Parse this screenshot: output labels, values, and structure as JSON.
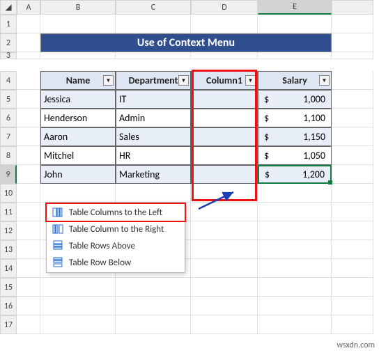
{
  "columns": [
    "A",
    "B",
    "C",
    "D",
    "E"
  ],
  "rows": [
    1,
    2,
    3,
    4,
    5,
    6,
    7,
    8,
    9,
    10,
    11,
    12,
    13,
    14,
    15,
    16,
    17
  ],
  "title": "Use of Context Menu",
  "headers": {
    "name": "Name",
    "dept": "Department",
    "col1": "Column1",
    "salary": "Salary"
  },
  "chart_data": {
    "type": "table",
    "columns": [
      "Name",
      "Department",
      "Column1",
      "Salary"
    ],
    "rows": [
      {
        "name": "Jessica",
        "dept": "IT",
        "col1": "",
        "salary": 1000,
        "salary_fmt": "1,000"
      },
      {
        "name": "Henderson",
        "dept": "Admin",
        "col1": "",
        "salary": 1100,
        "salary_fmt": "1,100"
      },
      {
        "name": "Aaron",
        "dept": "Sales",
        "col1": "",
        "salary": 1150,
        "salary_fmt": "1,150"
      },
      {
        "name": "Mitchel",
        "dept": "HR",
        "col1": "",
        "salary": 1050,
        "salary_fmt": "1,050"
      },
      {
        "name": "John",
        "dept": "Marketing",
        "col1": "",
        "salary": 1200,
        "salary_fmt": "1,200"
      }
    ]
  },
  "currency": "$",
  "menu": {
    "items": [
      {
        "label": "Table Columns to the Left",
        "icon": "insert-col-left-icon"
      },
      {
        "label": "Table Column to the Right",
        "icon": "insert-col-right-icon"
      },
      {
        "label": "Table Rows Above",
        "icon": "insert-row-above-icon"
      },
      {
        "label": "Table Row Below",
        "icon": "insert-row-below-icon"
      }
    ]
  },
  "watermark": "wsxdn.com"
}
